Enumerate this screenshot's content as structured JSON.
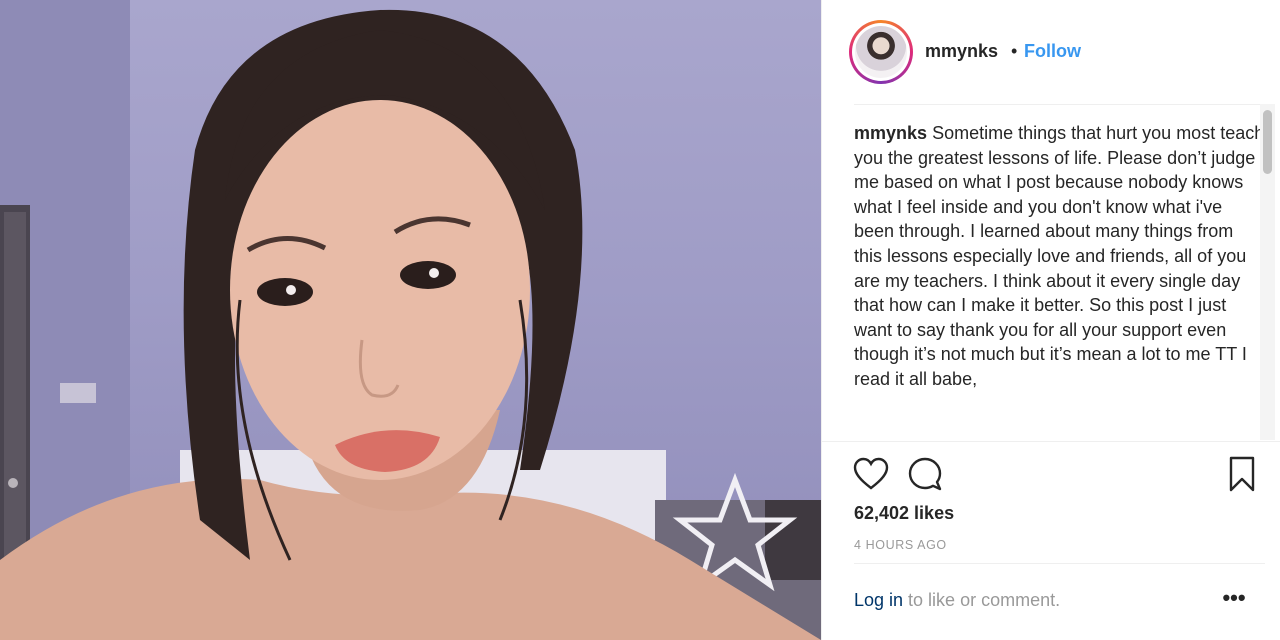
{
  "post": {
    "photo_icon": "portrait-photo",
    "username": "mmynks",
    "follow_label": "Follow",
    "separator": "•",
    "caption": "Sometime things that hurt you most teach you the greatest lessons of life. Please don’t judge me based on what I post because nobody knows what I feel inside and you don't know what i've been through. I learned about many things from this lessons especially love and friends, all of you are my teachers. I think about it every single day that how can I make it better. So this post I just want to say thank you for all your support even though it’s not much but it’s mean a lot to me TT I read it all babe,",
    "likes": "62,402 likes",
    "timestamp": "4 HOURS AGO",
    "login_link": "Log in",
    "login_rest": " to like or comment.",
    "more_label": "•••"
  },
  "icons": {
    "like": "heart-icon",
    "comment": "comment-icon",
    "save": "bookmark-icon",
    "more": "more-options-icon"
  },
  "colors": {
    "link_blue": "#3897f0",
    "login_link": "#003569",
    "muted": "#999999",
    "text": "#262626"
  }
}
